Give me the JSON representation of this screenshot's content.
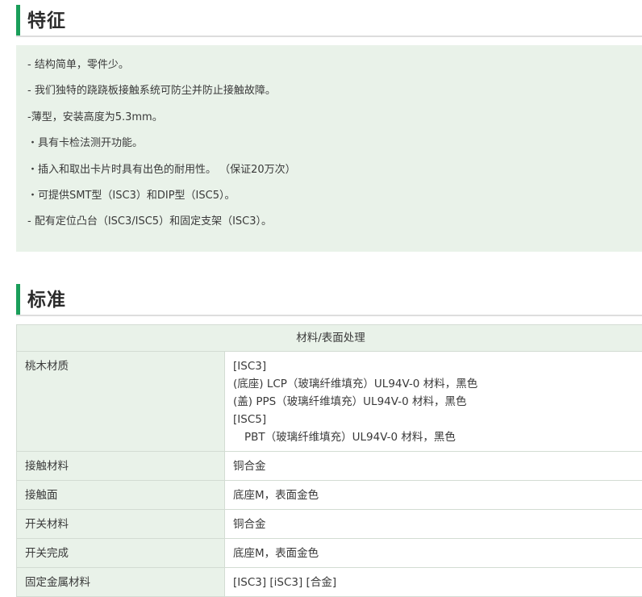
{
  "features": {
    "heading": "特征",
    "items": [
      "- 结构简单，零件少。",
      "- 我们独特的跷跷板接触系统可防尘并防止接触故障。",
      "-薄型，安装高度为5.3mm。",
      "・具有卡检法测开功能。",
      "・插入和取出卡片时具有出色的耐用性。 （保证20万次）",
      "・可提供SMT型（ISC3）和DIP型（ISC5）。",
      "- 配有定位凸台（ISC3/ISC5）和固定支架（ISC3）。"
    ]
  },
  "standards": {
    "heading": "标准",
    "table_header": "材料/表面处理",
    "rows": [
      {
        "label": "桃木材质",
        "lines": [
          "[ISC3]",
          "(底座) LCP（玻璃纤维填充）UL94V-0 材料，黑色",
          "(盖) PPS（玻璃纤维填充）UL94V-0 材料，黑色",
          "[ISC5]",
          "PBT（玻璃纤维填充）UL94V-0 材料，黑色"
        ]
      },
      {
        "label": "接触材料",
        "value": "铜合金"
      },
      {
        "label": "接触面",
        "value": "底座M，表面金色"
      },
      {
        "label": "开关材料",
        "value": "铜合金"
      },
      {
        "label": "开关完成",
        "value": "底座M，表面金色"
      },
      {
        "label": "固定金属材料",
        "value": "[ISC3] [iSC3] [合金]"
      }
    ]
  },
  "colors": {
    "accent": "#1a9e5a",
    "panel_bg": "#e9f2e9"
  }
}
